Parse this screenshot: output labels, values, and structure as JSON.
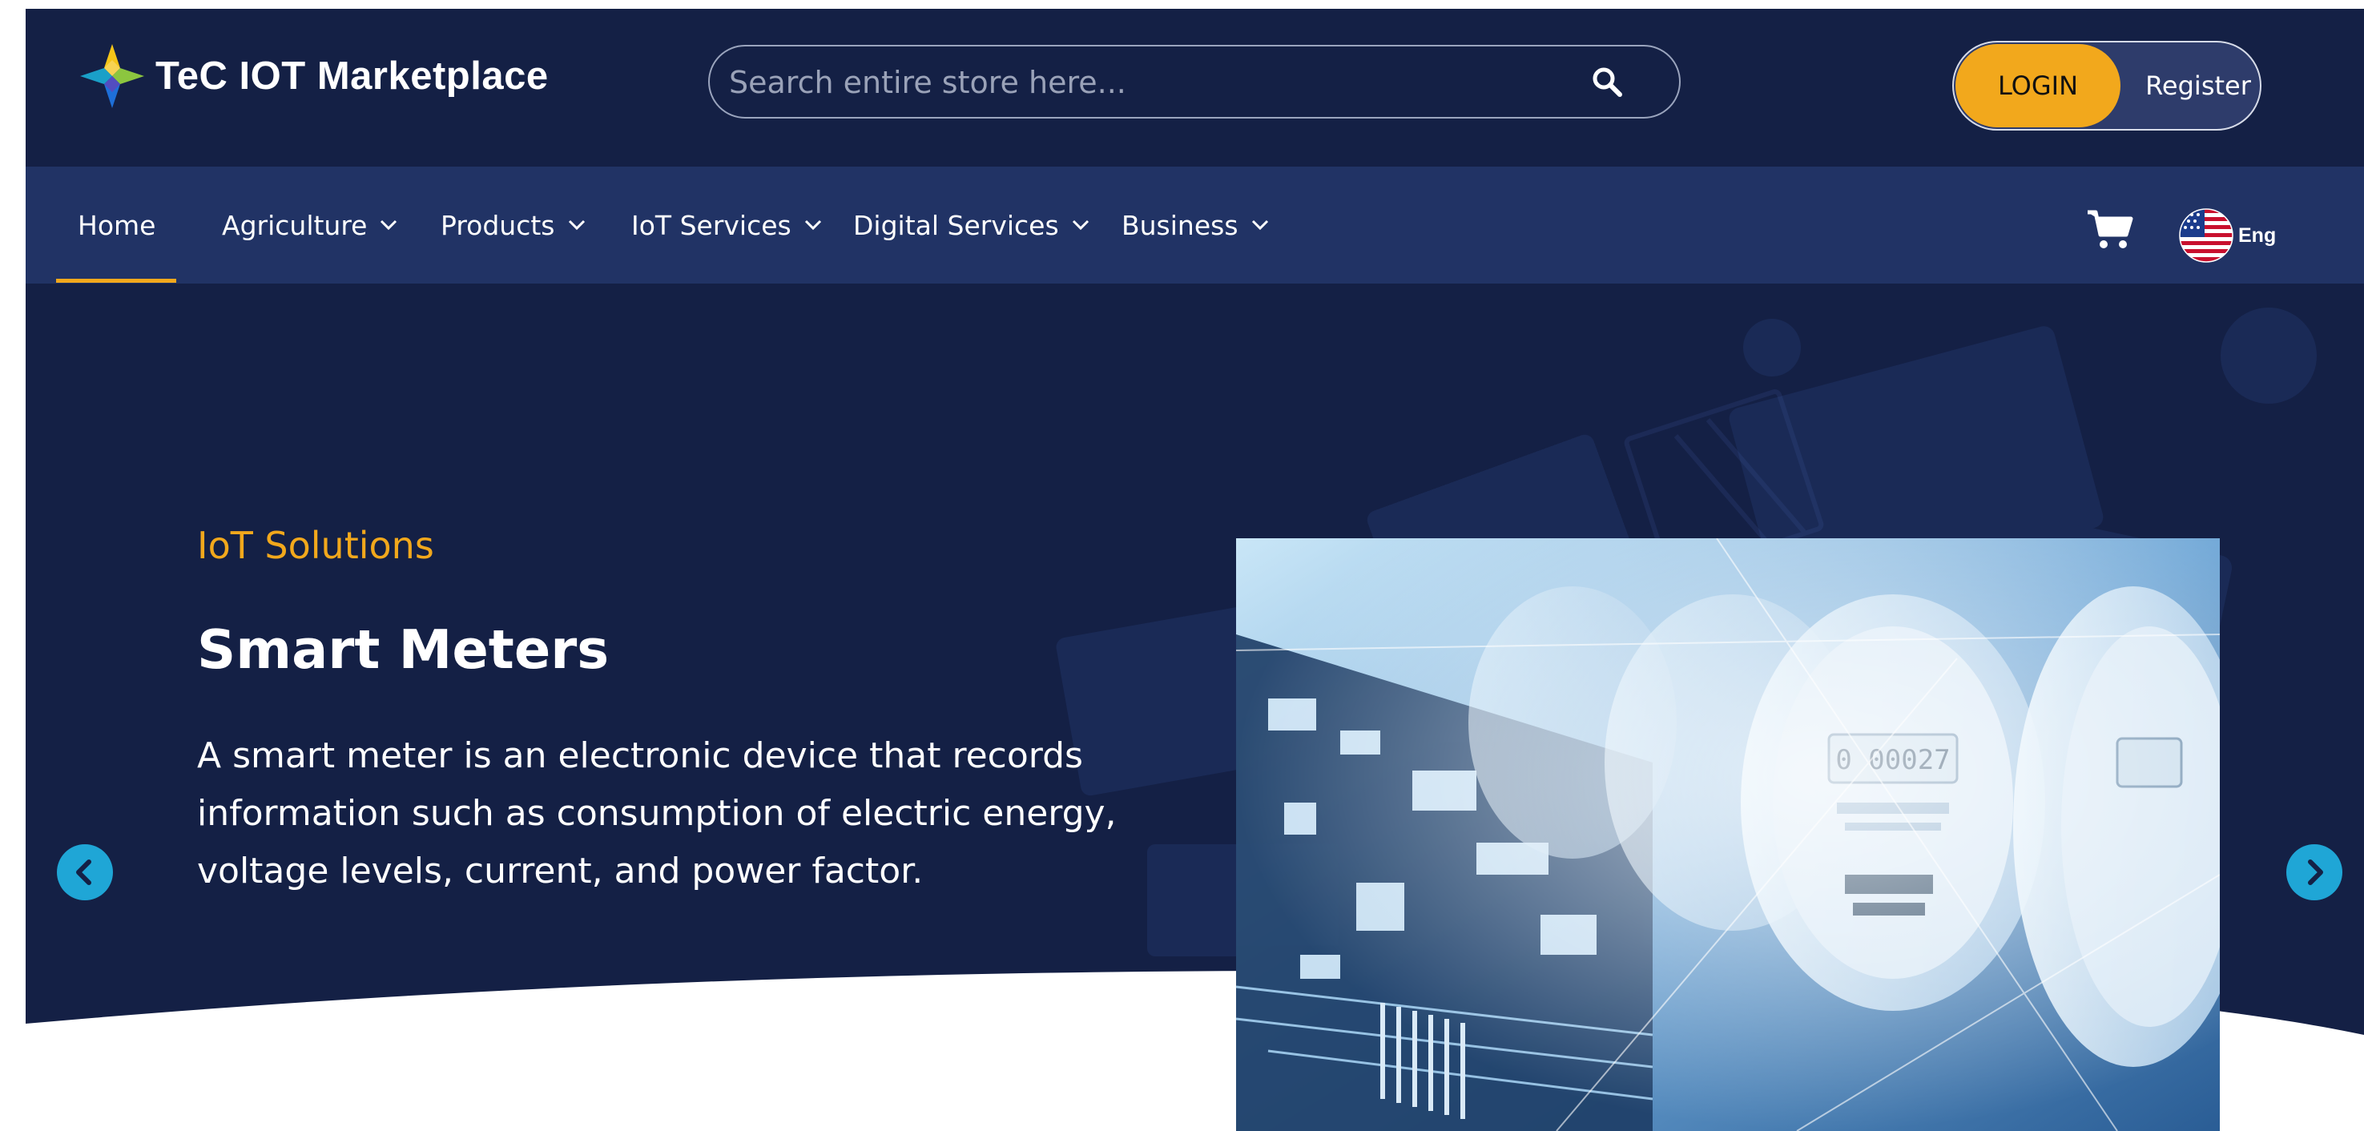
{
  "header": {
    "brand": "TeC IOT Marketplace",
    "search": {
      "placeholder": "Search entire store here..."
    },
    "login_label": "LOGIN",
    "register_label": "Register"
  },
  "nav": {
    "items": [
      {
        "label": "Home",
        "active": true
      },
      {
        "label": "Agriculture",
        "dropdown": true
      },
      {
        "label": "Products",
        "dropdown": true
      },
      {
        "label": "IoT Services",
        "dropdown": true
      },
      {
        "label": "Digital Services",
        "dropdown": true
      },
      {
        "label": "Business",
        "dropdown": true
      }
    ],
    "language": "Eng"
  },
  "hero": {
    "eyebrow": "IoT Solutions",
    "title": "Smart Meters",
    "description": "A smart meter is an electronic device that records information such as consumption of electric energy, voltage levels, current, and power factor."
  },
  "colors": {
    "header_bg": "#142045",
    "nav_bg": "#213365",
    "accent": "#f2a81c",
    "arrow": "#1fa6d6"
  },
  "icons": [
    "logo-mark",
    "search-icon",
    "chevron-down-icon",
    "cart-icon",
    "us-flag-icon",
    "chevron-left-icon",
    "chevron-right-icon"
  ]
}
